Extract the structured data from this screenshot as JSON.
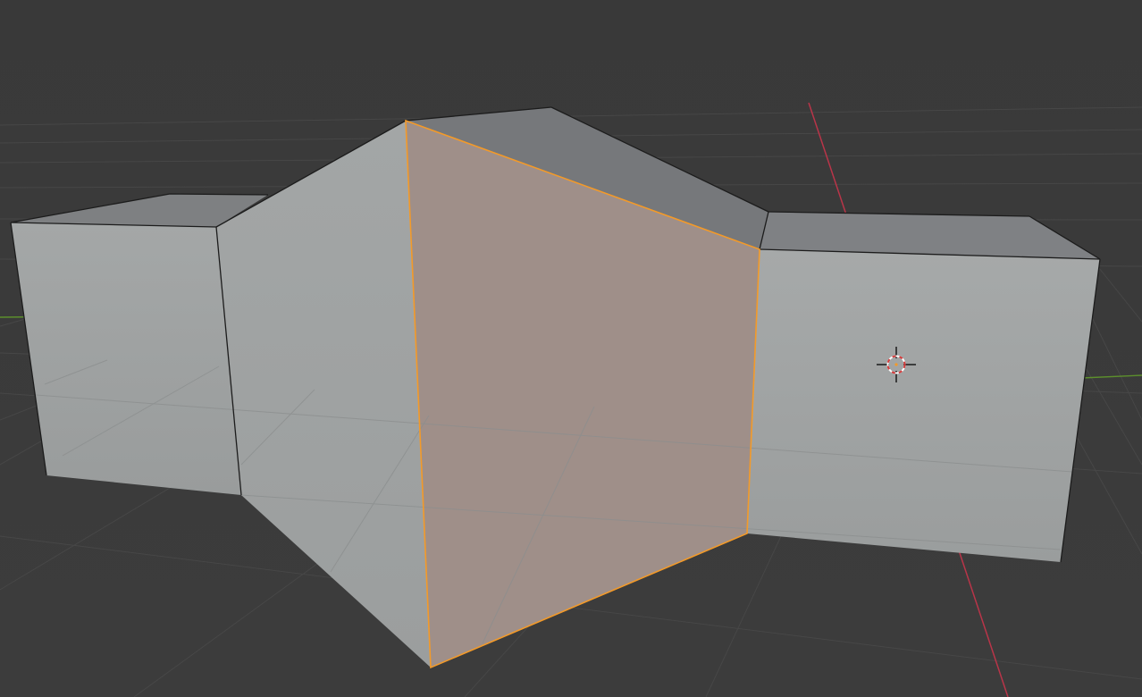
{
  "viewport": {
    "background": "#3a3a3a",
    "grid_color": "#4c4c4c",
    "x_axis_color": "#c0384f",
    "y_axis_color": "#5f9a2c"
  },
  "mesh": {
    "object_type": "extruded-cube-mesh",
    "face_color": "#a0a3a3",
    "top_face_color": "#7f8183",
    "side_face_color": "#9ea2a2",
    "edge_color": "#1a1a1a",
    "selected_face_color": "#a0908a",
    "selected_edge_color": "#f39a29"
  },
  "cursor": {
    "icon": "3d-cursor-icon",
    "ring_color_a": "#d43b3b",
    "ring_color_b": "#ffffff"
  }
}
